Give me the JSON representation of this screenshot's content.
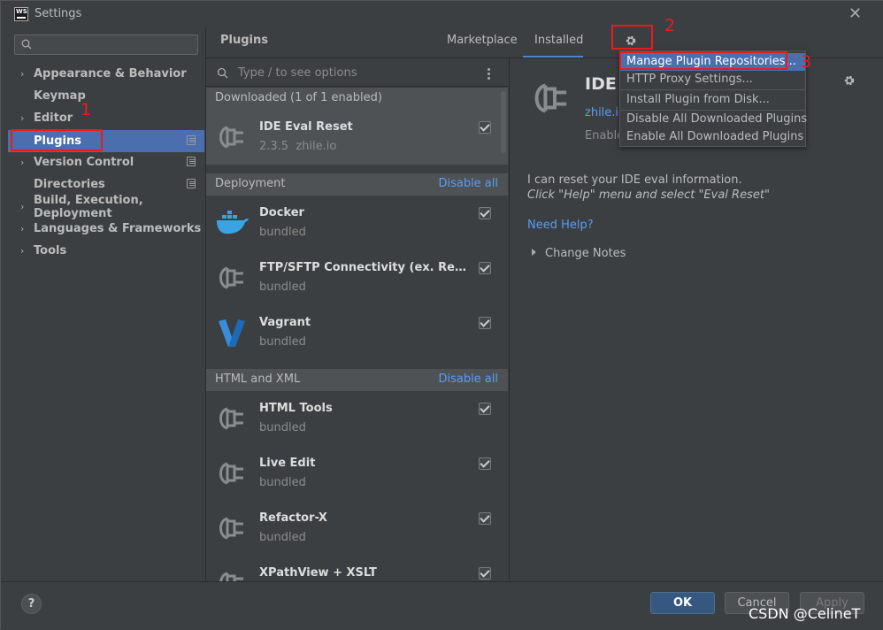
{
  "window": {
    "title": "Settings",
    "app_icon": "WS"
  },
  "sidebar": {
    "search_placeholder": "",
    "items": [
      {
        "label": "Appearance & Behavior",
        "expandable": true
      },
      {
        "label": "Keymap",
        "expandable": false
      },
      {
        "label": "Editor",
        "expandable": true
      },
      {
        "label": "Plugins",
        "expandable": false,
        "selected": true
      },
      {
        "label": "Version Control",
        "expandable": true
      },
      {
        "label": "Directories",
        "expandable": false
      },
      {
        "label": "Build, Execution, Deployment",
        "expandable": true
      },
      {
        "label": "Languages & Frameworks",
        "expandable": true
      },
      {
        "label": "Tools",
        "expandable": true
      }
    ]
  },
  "header": {
    "title": "Plugins",
    "tabs": [
      "Marketplace",
      "Installed"
    ],
    "active_tab": "Installed"
  },
  "plugin_list": {
    "search_placeholder": "Type / to see options",
    "groups": [
      {
        "title": "Downloaded (1 of 1 enabled)",
        "action": ""
      },
      {
        "title": "Deployment",
        "action": "Disable all"
      },
      {
        "title": "HTML and XML",
        "action": "Disable all"
      }
    ],
    "plugins": [
      {
        "name": "IDE Eval Reset",
        "version": "2.3.5",
        "vendor": "zhile.io",
        "checked": true
      },
      {
        "name": "Docker",
        "sub": "bundled",
        "checked": true
      },
      {
        "name": "FTP/SFTP Connectivity (ex. Remote Hosts Access)",
        "sub": "bundled",
        "checked": true
      },
      {
        "name": "Vagrant",
        "sub": "bundled",
        "checked": true
      },
      {
        "name": "HTML Tools",
        "sub": "bundled",
        "checked": true
      },
      {
        "name": "Live Edit",
        "sub": "bundled",
        "checked": true
      },
      {
        "name": "Refactor-X",
        "sub": "bundled",
        "checked": true
      },
      {
        "name": "XPathView + XSLT",
        "sub": "bundled",
        "checked": true
      }
    ]
  },
  "details": {
    "name": "IDE E",
    "link": "zhile.io",
    "status": "Enabled",
    "desc_line1": "I can reset your IDE eval information.",
    "desc_line2": "Click \"Help\" menu and select \"Eval Reset\"",
    "help_link": "Need Help?",
    "change_notes": "Change Notes"
  },
  "popup_menu": {
    "items": [
      "Manage Plugin Repositories...",
      "HTTP Proxy Settings...",
      "Install Plugin from Disk...",
      "Disable All Downloaded Plugins",
      "Enable All Downloaded Plugins"
    ],
    "highlighted": "Manage Plugin Repositories..."
  },
  "annotations": {
    "n1": "1",
    "n2": "2",
    "n3": "3"
  },
  "footer": {
    "help": "?",
    "ok": "OK",
    "cancel": "Cancel",
    "apply": "Apply"
  },
  "watermark": "CSDN @CelineT",
  "colors": {
    "accent": "#4b6eaf",
    "link": "#589df6",
    "annotation": "#e81c1c",
    "background": "#3c3f41"
  }
}
